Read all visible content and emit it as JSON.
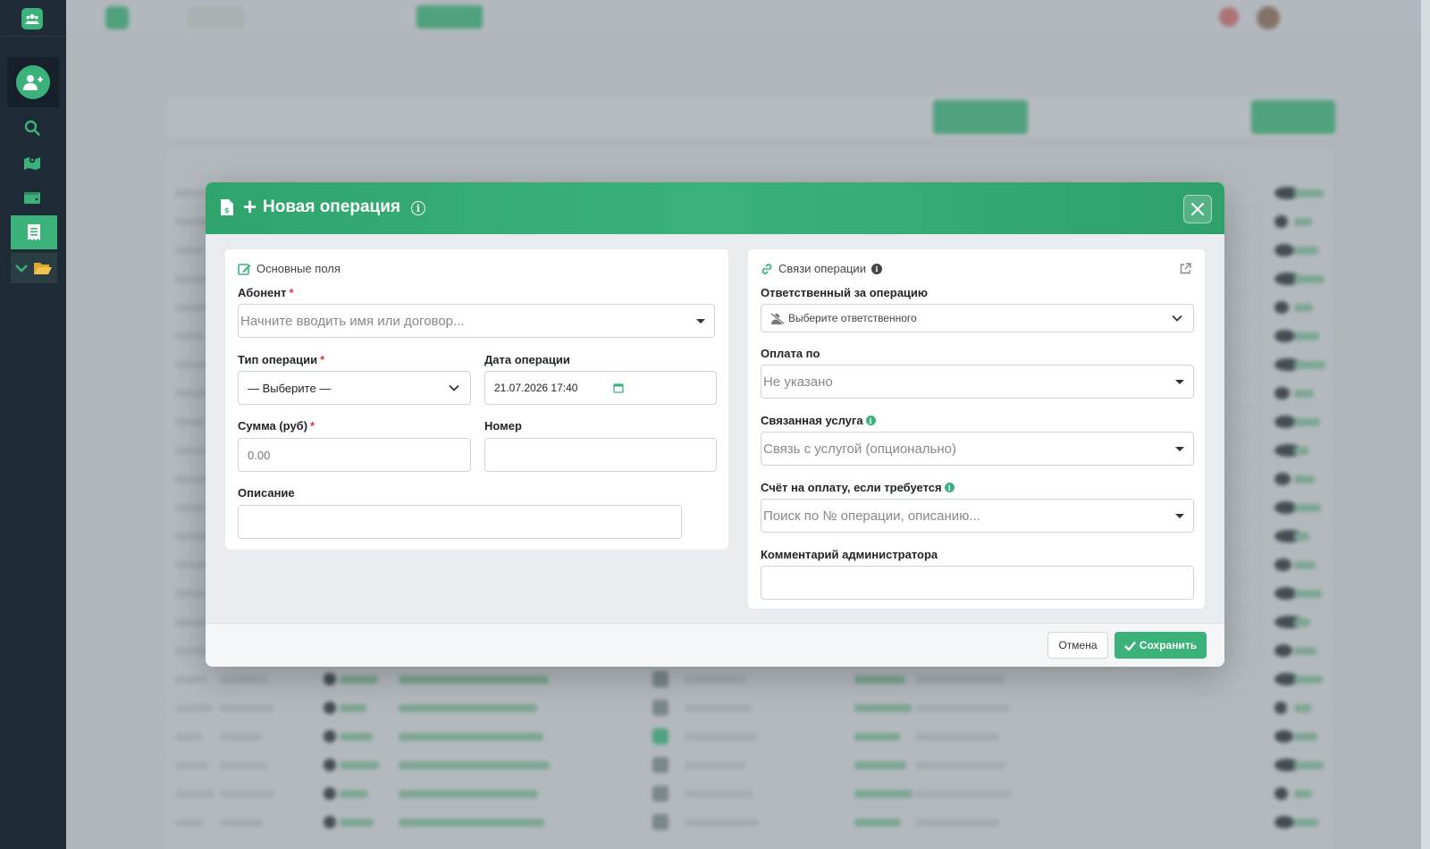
{
  "modal": {
    "title": "Новая операция",
    "left_card": {
      "title": "Основные поля",
      "subscriber_label": "Абонент",
      "subscriber_placeholder": "Начните вводить имя или договор...",
      "op_type_label": "Тип операции",
      "op_type_value": "— Выберите —",
      "op_date_label": "Дата операции",
      "op_date_value": "21.07.2026 17:40",
      "sum_label": "Сумма (руб)",
      "sum_placeholder": "0.00",
      "number_label": "Номер",
      "description_label": "Описание",
      "required_mark": "*"
    },
    "right_card": {
      "title": "Связи операции",
      "responsible_label": "Ответственный за операцию",
      "responsible_value": "Выберите ответственного",
      "payment_by_label": "Оплата по",
      "payment_by_value": "Не указано",
      "service_label": "Связанная услуга",
      "service_placeholder": "Связь с услугой (опционально)",
      "invoice_label": "Счёт на оплату, если требуется",
      "invoice_placeholder": "Поиск по № операции, описанию...",
      "admin_comment_label": "Комментарий администратора"
    },
    "footer": {
      "cancel_label": "Отмена",
      "save_label": "Сохранить"
    }
  },
  "colors": {
    "accent": "#3bb27a",
    "sidebar": "#1e2b36",
    "required": "#dc3545"
  },
  "icons": {
    "sidebar": [
      "users-icon",
      "add-user-icon",
      "search-icon",
      "map-icon",
      "wallet-icon",
      "receipt-icon",
      "chevron-down-icon",
      "folder-open-icon"
    ],
    "modal": [
      "file-invoice-icon",
      "plus-icon",
      "info-icon",
      "close-icon",
      "edit-icon",
      "link-icon",
      "external-link-icon",
      "user-slash-icon",
      "calendar-icon",
      "check-icon"
    ]
  }
}
